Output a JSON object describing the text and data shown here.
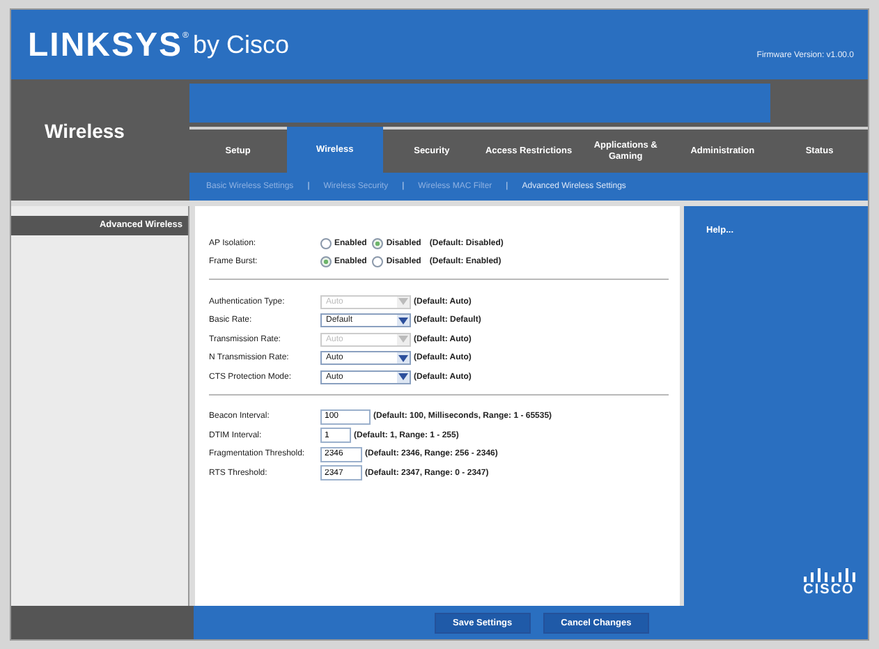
{
  "header": {
    "logo": "LINKSYS",
    "logo_mark": "®",
    "logo_suffix": "by Cisco",
    "firmware": "Firmware Version: v1.00.0"
  },
  "section_title": "Wireless",
  "tabs": [
    {
      "label": "Setup",
      "selected": false
    },
    {
      "label": "Wireless",
      "selected": true
    },
    {
      "label": "Security",
      "selected": false
    },
    {
      "label": "Access Restrictions",
      "selected": false
    },
    {
      "label": "Applications & Gaming",
      "selected": false
    },
    {
      "label": "Administration",
      "selected": false
    },
    {
      "label": "Status",
      "selected": false
    }
  ],
  "subtab_separator": "|",
  "subtabs": [
    {
      "label": "Basic Wireless Settings",
      "selected": false
    },
    {
      "label": "Wireless Security",
      "selected": false
    },
    {
      "label": "Wireless MAC Filter",
      "selected": false
    },
    {
      "label": "Advanced Wireless Settings",
      "selected": true
    }
  ],
  "sidebar_title": "Advanced Wireless",
  "groups": [
    [
      {
        "kind": "radio",
        "label": "AP Isolation:",
        "options": [
          {
            "label": "Enabled",
            "selected": false
          },
          {
            "label": "Disabled",
            "selected": true
          }
        ],
        "note": "(Default: Disabled)"
      },
      {
        "kind": "radio",
        "label": "Frame Burst:",
        "options": [
          {
            "label": "Enabled",
            "selected": true
          },
          {
            "label": "Disabled",
            "selected": false
          }
        ],
        "note": "(Default: Enabled)"
      }
    ],
    [
      {
        "kind": "select",
        "label": "Authentication Type:",
        "value": "Auto",
        "disabled": true,
        "note": "(Default: Auto)"
      },
      {
        "kind": "select",
        "label": "Basic Rate:",
        "value": "Default",
        "disabled": false,
        "note": "(Default: Default)"
      },
      {
        "kind": "select",
        "label": "Transmission Rate:",
        "value": "Auto",
        "disabled": true,
        "note": "(Default: Auto)"
      },
      {
        "kind": "select",
        "label": "N Transmission Rate:",
        "value": "Auto",
        "disabled": false,
        "note": "(Default: Auto)"
      },
      {
        "kind": "select",
        "label": "CTS Protection Mode:",
        "value": "Auto",
        "disabled": false,
        "note": "(Default: Auto)"
      }
    ],
    [
      {
        "kind": "text",
        "label": "Beacon Interval:",
        "value": "100",
        "note": "(Default: 100, Milliseconds, Range: 1 - 65535)"
      },
      {
        "kind": "text",
        "label": "DTIM Interval:",
        "value": "1",
        "note": "(Default: 1, Range: 1 - 255)"
      },
      {
        "kind": "text",
        "label": "Fragmentation Threshold:",
        "value": "2346",
        "note": "(Default: 2346, Range: 256 - 2346)"
      },
      {
        "kind": "text",
        "label": "RTS Threshold:",
        "value": "2347",
        "note": "(Default: 2347, Range: 0 - 2347)"
      }
    ]
  ],
  "help_link": "Help...",
  "cisco_wordmark": "CISCO",
  "buttons": [
    "Save Settings",
    "Cancel Changes"
  ]
}
